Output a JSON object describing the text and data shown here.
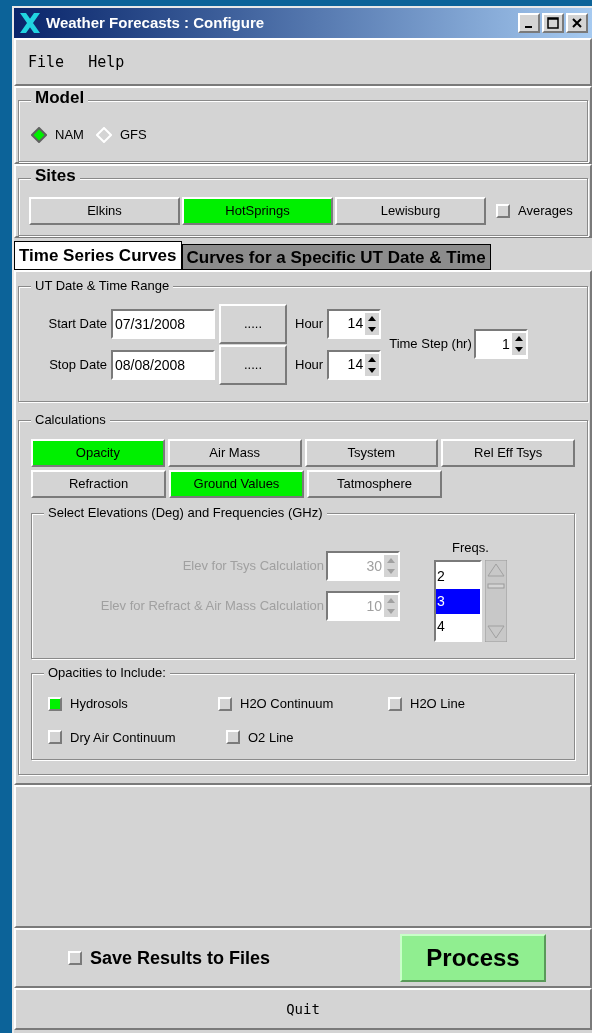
{
  "window": {
    "title": "Weather Forecasts : Configure"
  },
  "menu": [
    "File",
    "Help"
  ],
  "model": {
    "title": "Model",
    "options": [
      {
        "label": "NAM",
        "selected": true
      },
      {
        "label": "GFS",
        "selected": false
      }
    ]
  },
  "sites": {
    "title": "Sites",
    "buttons": [
      {
        "label": "Elkins",
        "selected": false
      },
      {
        "label": "HotSprings",
        "selected": true
      },
      {
        "label": "Lewisburg",
        "selected": false
      }
    ],
    "averages": {
      "label": "Averages",
      "checked": false
    }
  },
  "tabs": [
    {
      "label": "Time Series Curves",
      "selected": true
    },
    {
      "label": "Curves for a Specific UT Date & Time",
      "selected": false
    }
  ],
  "date_range": {
    "title": "UT Date & Time Range",
    "rows": [
      {
        "label": "Start Date",
        "value": "07/31/2008",
        "button": ".....",
        "hour_label": "Hour",
        "hour": "14"
      },
      {
        "label": "Stop Date",
        "value": "08/08/2008",
        "button": ".....",
        "hour_label": "Hour",
        "hour": "14"
      }
    ],
    "step_label": "Time Step (hr)",
    "step": "1"
  },
  "calculations": {
    "title": "Calculations",
    "rows": [
      [
        {
          "label": "Opacity",
          "selected": true
        },
        {
          "label": "Air Mass",
          "selected": false
        },
        {
          "label": "Tsystem",
          "selected": false
        },
        {
          "label": "Rel Eff Tsys",
          "selected": false
        }
      ],
      [
        {
          "label": "Refraction",
          "selected": false
        },
        {
          "label": "Ground Values",
          "selected": true
        },
        {
          "label": "Tatmosphere",
          "selected": false
        }
      ]
    ]
  },
  "elevations": {
    "title": "Select Elevations (Deg) and Frequencies (GHz)",
    "fields": [
      {
        "label": "Elev for Tsys Calculation",
        "value": "30",
        "disabled": true
      },
      {
        "label": "Elev for Refract & Air Mass Calculation",
        "value": "10",
        "disabled": true
      }
    ],
    "freqs_label": "Freqs.",
    "freqs": [
      {
        "label": "2",
        "selected": false
      },
      {
        "label": "3",
        "selected": true
      },
      {
        "label": "4",
        "selected": false
      }
    ]
  },
  "opacities": {
    "title": "Opacities to Include:",
    "rows": [
      [
        {
          "label": "Hydrosols",
          "checked": true
        },
        {
          "label": "H2O Continuum",
          "checked": false
        },
        {
          "label": "H2O Line",
          "checked": false
        }
      ],
      [
        {
          "label": "Dry Air Continuum",
          "checked": false
        },
        {
          "label": "O2 Line",
          "checked": false
        }
      ]
    ]
  },
  "save": {
    "label": "Save Results to Files",
    "checked": false
  },
  "process": "Process",
  "quit": "Quit"
}
